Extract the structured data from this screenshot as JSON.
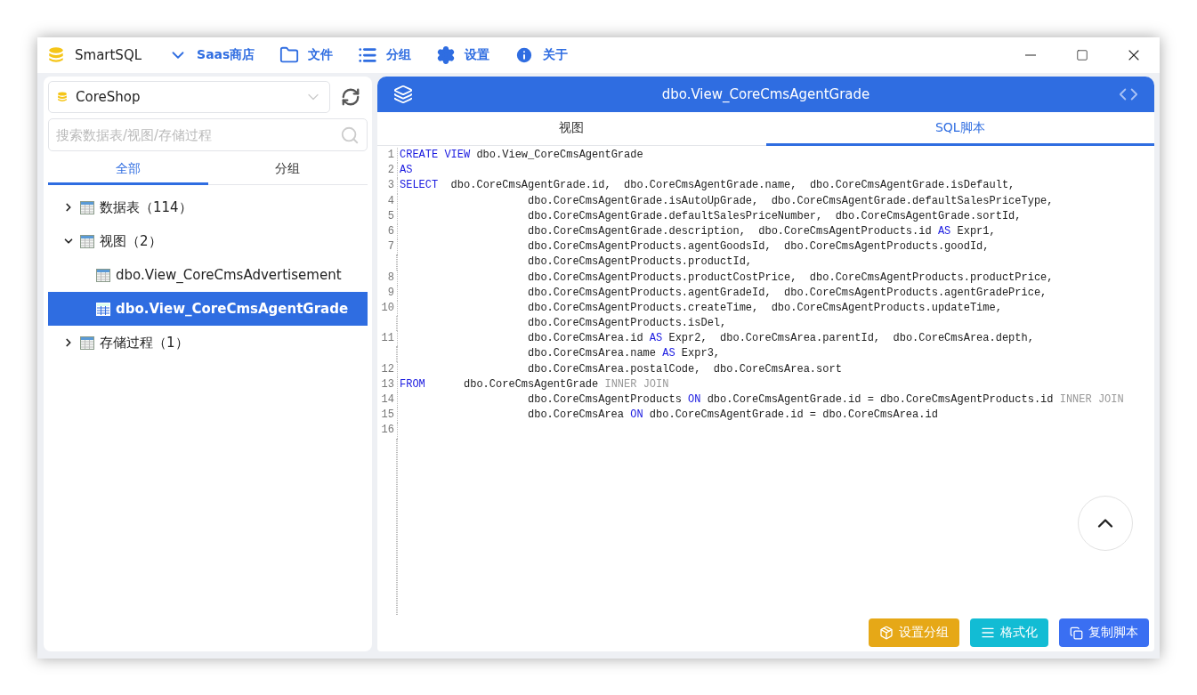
{
  "app": {
    "title": "SmartSQL"
  },
  "menu": [
    {
      "kind": "store",
      "label": "Saas商店"
    },
    {
      "kind": "file",
      "label": "文件"
    },
    {
      "kind": "group",
      "label": "分组"
    },
    {
      "kind": "settings",
      "label": "设置"
    },
    {
      "kind": "about",
      "label": "关于"
    }
  ],
  "sidebar": {
    "database": {
      "value": "CoreShop"
    },
    "search": {
      "placeholder": "搜索数据表/视图/存储过程"
    },
    "tabs": [
      {
        "label": "全部",
        "selected": true
      },
      {
        "label": "分组",
        "selected": false
      }
    ],
    "tree": [
      {
        "label": "数据表（114）",
        "expanded": false,
        "selected": false
      },
      {
        "label": "视图（2）",
        "expanded": true,
        "selected": false,
        "children": [
          {
            "label": "dbo.View_CoreCmsAdvertisement",
            "selected": false
          },
          {
            "label": "dbo.View_CoreCmsAgentGrade",
            "selected": true
          }
        ]
      },
      {
        "label": "存储过程（1）",
        "expanded": false,
        "selected": false
      }
    ]
  },
  "editor": {
    "title": "dbo.View_CoreCmsAgentGrade",
    "tabs": [
      {
        "label": "视图",
        "selected": false
      },
      {
        "label": "SQL脚本",
        "selected": true
      }
    ],
    "lines": [
      {
        "number": "1",
        "kind": "statement",
        "tokens": [
          {
            "kind": "keyword",
            "text": "CREATE VIEW"
          },
          {
            "kind": "plain",
            "text": " dbo.View_CoreCmsAgentGrade"
          }
        ]
      },
      {
        "number": "2",
        "kind": "statement",
        "tokens": [
          {
            "kind": "keyword",
            "text": "AS"
          }
        ]
      },
      {
        "number": "3",
        "kind": "statement",
        "tokens": [
          {
            "kind": "keyword",
            "text": "SELECT"
          },
          {
            "kind": "plain",
            "text": "  dbo.CoreCmsAgentGrade.id,  dbo.CoreCmsAgentGrade.name,  dbo.CoreCmsAgentGrade.isDefault,"
          }
        ]
      },
      {
        "number": "4",
        "kind": "continuation",
        "tokens": [
          {
            "kind": "plain",
            "text": "dbo.CoreCmsAgentGrade.isAutoUpGrade,  dbo.CoreCmsAgentGrade.defaultSalesPriceType,"
          }
        ]
      },
      {
        "number": "5",
        "kind": "continuation",
        "tokens": [
          {
            "kind": "plain",
            "text": "dbo.CoreCmsAgentGrade.defaultSalesPriceNumber,  dbo.CoreCmsAgentGrade.sortId,"
          }
        ]
      },
      {
        "number": "6",
        "kind": "continuation",
        "tokens": [
          {
            "kind": "plain",
            "text": "dbo.CoreCmsAgentGrade.description,  dbo.CoreCmsAgentProducts.id "
          },
          {
            "kind": "keyword",
            "text": "AS"
          },
          {
            "kind": "plain",
            "text": " Expr1,"
          }
        ]
      },
      {
        "number": "7",
        "kind": "continuation",
        "tokens": [
          {
            "kind": "plain",
            "text": "dbo.CoreCmsAgentProducts.agentGoodsId,  dbo.CoreCmsAgentProducts.goodId,"
          }
        ]
      },
      {
        "kind": "continuation",
        "tokens": [
          {
            "kind": "plain",
            "text": "dbo.CoreCmsAgentProducts.productId,"
          }
        ]
      },
      {
        "number": "8",
        "kind": "continuation",
        "tokens": [
          {
            "kind": "plain",
            "text": "dbo.CoreCmsAgentProducts.productCostPrice,  dbo.CoreCmsAgentProducts.productPrice,"
          }
        ]
      },
      {
        "number": "9",
        "kind": "continuation",
        "tokens": [
          {
            "kind": "plain",
            "text": "dbo.CoreCmsAgentProducts.agentGradeId,  dbo.CoreCmsAgentProducts.agentGradePrice,"
          }
        ]
      },
      {
        "number": "10",
        "kind": "continuation",
        "tokens": [
          {
            "kind": "plain",
            "text": "dbo.CoreCmsAgentProducts.createTime,  dbo.CoreCmsAgentProducts.updateTime,"
          }
        ]
      },
      {
        "kind": "continuation",
        "tokens": [
          {
            "kind": "plain",
            "text": "dbo.CoreCmsAgentProducts.isDel,"
          }
        ]
      },
      {
        "number": "11",
        "kind": "continuation",
        "tokens": [
          {
            "kind": "plain",
            "text": "dbo.CoreCmsArea.id "
          },
          {
            "kind": "keyword",
            "text": "AS"
          },
          {
            "kind": "plain",
            "text": " Expr2,  dbo.CoreCmsArea.parentId,  dbo.CoreCmsArea.depth,"
          }
        ]
      },
      {
        "kind": "continuation",
        "tokens": [
          {
            "kind": "plain",
            "text": "dbo.CoreCmsArea.name "
          },
          {
            "kind": "keyword",
            "text": "AS"
          },
          {
            "kind": "plain",
            "text": " Expr3,"
          }
        ]
      },
      {
        "number": "12",
        "kind": "continuation",
        "tokens": [
          {
            "kind": "plain",
            "text": "dbo.CoreCmsArea.postalCode,  dbo.CoreCmsArea.sort"
          }
        ]
      },
      {
        "number": "13",
        "kind": "statement",
        "tokens": [
          {
            "kind": "keyword",
            "text": "FROM"
          },
          {
            "kind": "plain",
            "text": "      dbo.CoreCmsAgentGrade "
          },
          {
            "kind": "muted",
            "text": "INNER JOIN"
          }
        ]
      },
      {
        "number": "14",
        "kind": "continuation",
        "tokens": [
          {
            "kind": "plain",
            "text": "dbo.CoreCmsAgentProducts "
          },
          {
            "kind": "keyword",
            "text": "ON"
          },
          {
            "kind": "plain",
            "text": " dbo.CoreCmsAgentGrade.id = dbo.CoreCmsAgentProducts.id "
          },
          {
            "kind": "muted",
            "text": "INNER JOIN"
          }
        ]
      },
      {
        "number": "15",
        "kind": "continuation",
        "tokens": [
          {
            "kind": "plain",
            "text": "dbo.CoreCmsArea "
          },
          {
            "kind": "keyword",
            "text": "ON"
          },
          {
            "kind": "plain",
            "text": " dbo.CoreCmsAgentGrade.id = dbo.CoreCmsArea.id"
          }
        ]
      },
      {
        "number": "16",
        "kind": "statement"
      }
    ],
    "actions": [
      {
        "kind": "group",
        "label": "设置分组",
        "color": "#e6a817"
      },
      {
        "kind": "format",
        "label": "格式化",
        "color": "#12bcd4"
      },
      {
        "kind": "copy",
        "label": "复制脚本",
        "color": "#3a6ff2"
      }
    ]
  }
}
